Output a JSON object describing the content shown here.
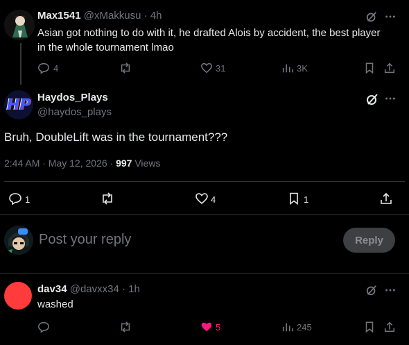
{
  "parent_post": {
    "display_name": "Max1541",
    "handle": "@xMakkusu",
    "sep": "·",
    "time": "4h",
    "text_line1": "Asian got nothing to do with it, he drafted Alois by accident, the best player",
    "text_line2": "in the whole tournament lmao",
    "replies": "4",
    "likes": "31",
    "views": "3K"
  },
  "main_post": {
    "display_name": "Haydos_Plays",
    "handle": "@haydos_plays",
    "avatar_letters": "HP",
    "text": "Bruh, DoubleLift was in the tournament???",
    "timestamp": "2:44 AM · May 12, 2026 · ",
    "views_count": "997",
    "views_label": " Views",
    "replies": "1",
    "likes": "4",
    "bookmarks": "1"
  },
  "composer": {
    "placeholder": "Post your reply",
    "button_label": "Reply"
  },
  "reply_post": {
    "display_name": "dav34",
    "handle": "@davxx34",
    "sep": "·",
    "time": "1h",
    "text": "washed",
    "likes": "5",
    "views": "245"
  },
  "colors": {
    "background": "#000000",
    "text": "#e7e9ea",
    "muted": "#71767b",
    "like_active": "#f91880",
    "divider": "#2f3336",
    "reply_avatar": "#ff3b3b"
  }
}
